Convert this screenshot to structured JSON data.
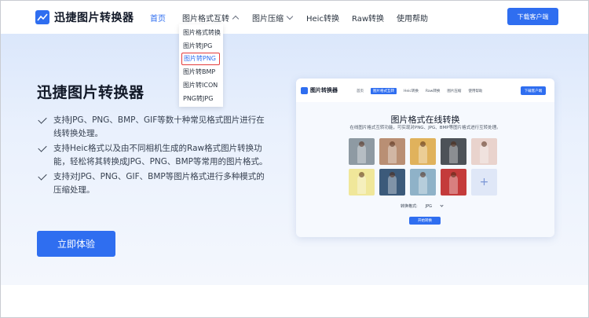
{
  "brand": {
    "name": "迅捷图片转换器",
    "accent": "#2f6ef0"
  },
  "nav": {
    "items": [
      {
        "label": "首页",
        "active": true
      },
      {
        "label": "图片格式互转",
        "has_dropdown": true,
        "open": true
      },
      {
        "label": "图片压缩",
        "has_dropdown": true,
        "open": false
      },
      {
        "label": "Heic转换"
      },
      {
        "label": "Raw转换"
      },
      {
        "label": "使用帮助"
      }
    ],
    "download_label": "下载客户端"
  },
  "dropdown": {
    "items": [
      {
        "label": "图片格式转换"
      },
      {
        "label": "图片转JPG"
      },
      {
        "label": "图片转PNG",
        "highlighted": true
      },
      {
        "label": "图片转BMP"
      },
      {
        "label": "图片转ICON"
      },
      {
        "label": "PNG转JPG"
      }
    ]
  },
  "hero": {
    "title": "迅捷图片转换器",
    "features": [
      "支持JPG、PNG、BMP、GIF等数十种常见格式图片进行在线转换处理。",
      "支持Heic格式以及由不同相机生成的Raw格式图片转换功能，轻松将其转换成JPG、PNG、BMP等常用的图片格式。",
      "支持对JPG、PNG、GIF、BMP等图片格式进行多种模式的压缩处理。"
    ],
    "cta_label": "立即体验"
  },
  "preview": {
    "logo": "图片转换器",
    "nav": [
      "首页",
      "图片格式互转",
      "Heic转换",
      "Raw转换",
      "图片压缩",
      "使用帮助"
    ],
    "download_label": "下载客户端",
    "title": "图片格式在线转换",
    "subtitle": "在线图片格式互转功能，可实现对PNG、JPG、BMP等图片格式进行互转处理。",
    "format_label": "转换格式:",
    "format_value": "JPG",
    "start_label": "开始转换",
    "add_symbol": "+",
    "thumb_colors": [
      "#8e9aa3",
      "#b98f74",
      "#e0b25c",
      "#4d5258",
      "#e9d3cd",
      "#f0e79a",
      "#3c5a7a",
      "#8fb2c8",
      "#c43b3b"
    ]
  }
}
